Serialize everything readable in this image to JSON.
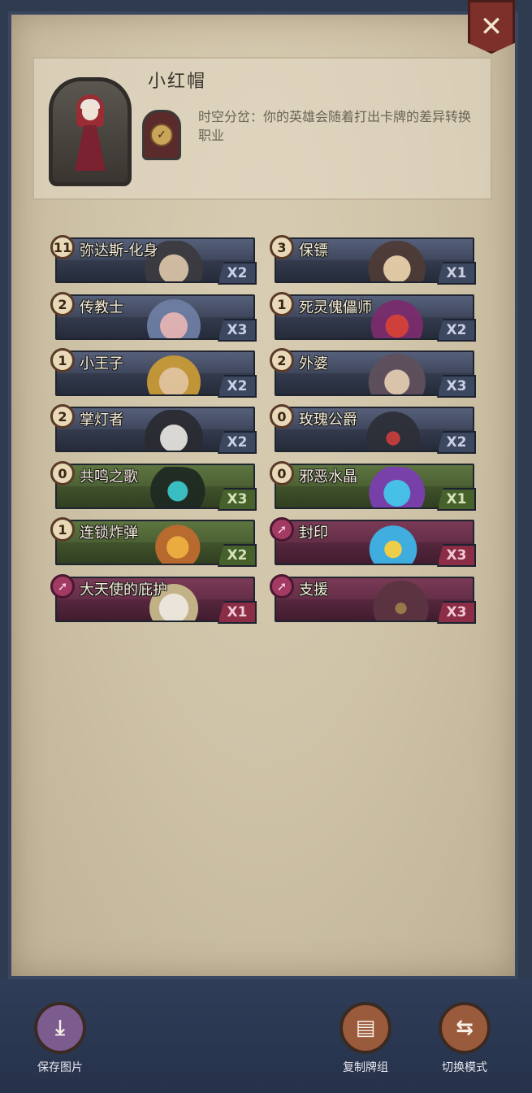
{
  "close": {
    "glyph": "✕"
  },
  "hero": {
    "name": "小红帽",
    "description": "时空分岔：你的英雄会随着打出卡牌的差异转换职业",
    "class_icon": "clock-icon"
  },
  "cards_left": [
    {
      "cost": "11",
      "name": "弥达斯-化身",
      "qty": "X2",
      "type": "gray"
    },
    {
      "cost": "2",
      "name": "传教士",
      "qty": "X3",
      "type": "gray"
    },
    {
      "cost": "1",
      "name": "小王子",
      "qty": "X2",
      "type": "gray"
    },
    {
      "cost": "2",
      "name": "掌灯者",
      "qty": "X2",
      "type": "gray"
    },
    {
      "cost": "0",
      "name": "共鸣之歌",
      "qty": "X3",
      "type": "green"
    },
    {
      "cost": "1",
      "name": "连锁炸弹",
      "qty": "X2",
      "type": "green"
    },
    {
      "cost": "",
      "name": "大天使的庇护",
      "qty": "X1",
      "type": "red"
    }
  ],
  "cards_right": [
    {
      "cost": "3",
      "name": "保镖",
      "qty": "X1",
      "type": "gray"
    },
    {
      "cost": "1",
      "name": "死灵傀儡师",
      "qty": "X2",
      "type": "gray"
    },
    {
      "cost": "2",
      "name": "外婆",
      "qty": "X3",
      "type": "gray"
    },
    {
      "cost": "0",
      "name": "玫瑰公爵",
      "qty": "X2",
      "type": "gray"
    },
    {
      "cost": "0",
      "name": "邪恶水晶",
      "qty": "X1",
      "type": "green"
    },
    {
      "cost": "",
      "name": "封印",
      "qty": "X3",
      "type": "red"
    },
    {
      "cost": "",
      "name": "支援",
      "qty": "X3",
      "type": "red"
    }
  ],
  "actions": {
    "save": {
      "label": "保存图片",
      "icon": "download-icon"
    },
    "copy": {
      "label": "复制牌组",
      "icon": "document-icon"
    },
    "switch": {
      "label": "切换模式",
      "icon": "swap-arrows-icon"
    }
  }
}
